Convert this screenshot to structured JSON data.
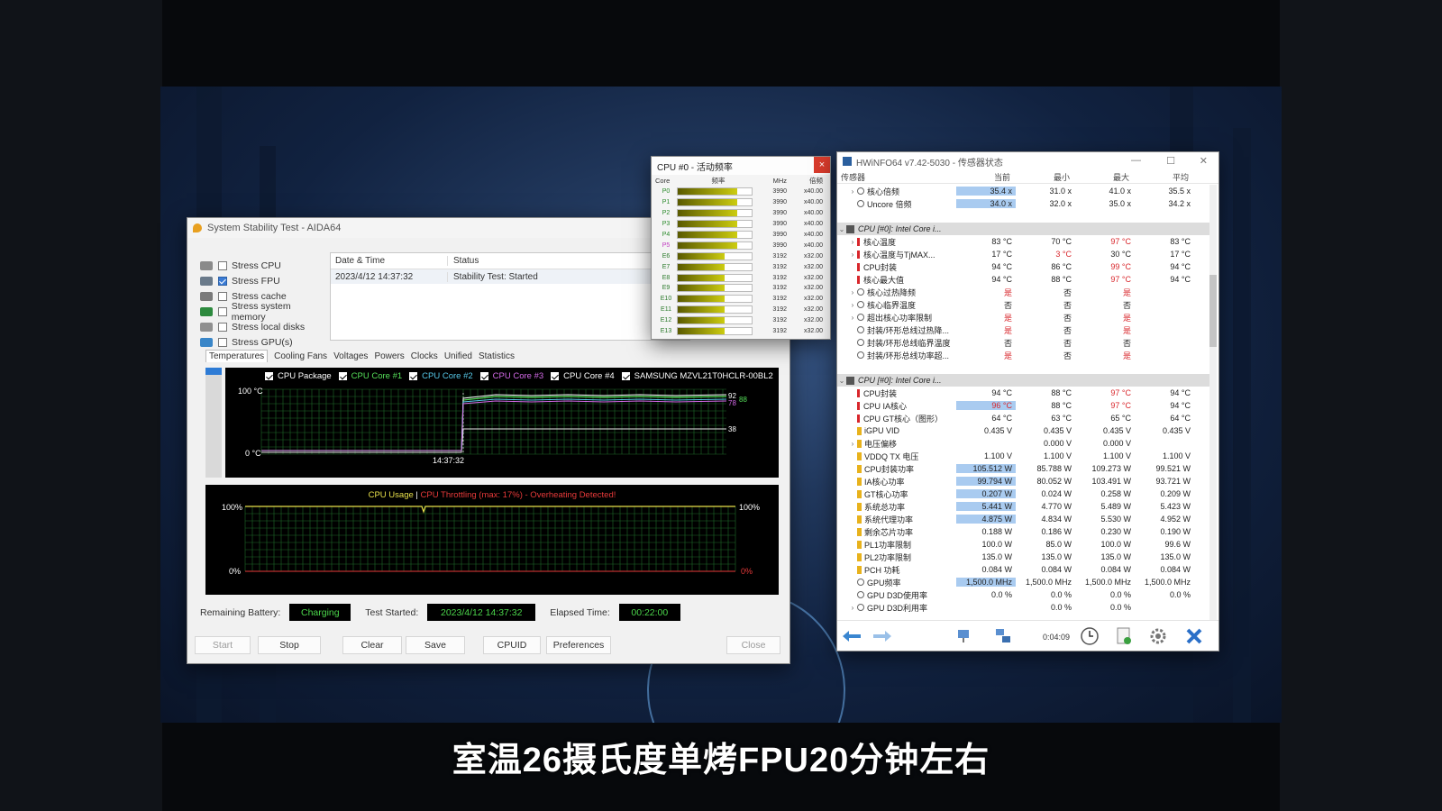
{
  "aida": {
    "title": "System Stability Test - AIDA64",
    "stress_items": [
      {
        "label": "Stress CPU",
        "checked": false
      },
      {
        "label": "Stress FPU",
        "checked": true
      },
      {
        "label": "Stress cache",
        "checked": false
      },
      {
        "label": "Stress system memory",
        "checked": false
      },
      {
        "label": "Stress local disks",
        "checked": false
      },
      {
        "label": "Stress GPU(s)",
        "checked": false
      }
    ],
    "table": {
      "col_datetime": "Date & Time",
      "col_status": "Status",
      "row_datetime": "2023/4/12 14:37:32",
      "row_status": "Stability Test: Started"
    },
    "tabs": [
      "Temperatures",
      "Cooling Fans",
      "Voltages",
      "Powers",
      "Clocks",
      "Unified",
      "Statistics"
    ],
    "temp_legend": [
      {
        "label": "CPU Package",
        "color": "#ffffff"
      },
      {
        "label": "CPU Core #1",
        "color": "#56e05a"
      },
      {
        "label": "CPU Core #2",
        "color": "#56c8e8"
      },
      {
        "label": "CPU Core #3",
        "color": "#d46ae8"
      },
      {
        "label": "CPU Core #4",
        "color": "#ffffff"
      },
      {
        "label": "SAMSUNG MZVL21T0HCLR-00BL2",
        "color": "#ffffff"
      }
    ],
    "temp_top_label": "100 °C",
    "temp_bottom_label": "0 °C",
    "temp_time_label": "14:37:32",
    "temp_readouts": [
      "92",
      "88",
      "78",
      "38"
    ],
    "usage_title_a": "CPU Usage",
    "usage_sep": "|",
    "usage_title_b": "CPU Throttling (max: 17%) - Overheating Detected!",
    "usage_left_top": "100%",
    "usage_left_bottom": "0%",
    "usage_right_top": "100%",
    "usage_right_bottom": "0%",
    "remaining_battery_label": "Remaining Battery:",
    "remaining_battery_value": "Charging",
    "test_started_label": "Test Started:",
    "test_started_value": "2023/4/12 14:37:32",
    "elapsed_label": "Elapsed Time:",
    "elapsed_value": "00:22:00",
    "buttons": {
      "start": "Start",
      "stop": "Stop",
      "clear": "Clear",
      "save": "Save",
      "cpuid": "CPUID",
      "preferences": "Preferences",
      "close": "Close"
    }
  },
  "freq": {
    "title": "CPU #0 - 活动频率",
    "close": "×",
    "hdr_core": "Core",
    "hdr_freq": "频率",
    "hdr_mhz": "MHz",
    "hdr_mult": "倍频",
    "rows": [
      {
        "core": "P0",
        "mhz": "3990",
        "mult": "x40.00",
        "fill": 0.8
      },
      {
        "core": "P1",
        "mhz": "3990",
        "mult": "x40.00",
        "fill": 0.8
      },
      {
        "core": "P2",
        "mhz": "3990",
        "mult": "x40.00",
        "fill": 0.8
      },
      {
        "core": "P3",
        "mhz": "3990",
        "mult": "x40.00",
        "fill": 0.8
      },
      {
        "core": "P4",
        "mhz": "3990",
        "mult": "x40.00",
        "fill": 0.8
      },
      {
        "core": "P5",
        "mhz": "3990",
        "mult": "x40.00",
        "fill": 0.8
      },
      {
        "core": "E6",
        "mhz": "3192",
        "mult": "x32.00",
        "fill": 0.64
      },
      {
        "core": "E7",
        "mhz": "3192",
        "mult": "x32.00",
        "fill": 0.64
      },
      {
        "core": "E8",
        "mhz": "3192",
        "mult": "x32.00",
        "fill": 0.64
      },
      {
        "core": "E9",
        "mhz": "3192",
        "mult": "x32.00",
        "fill": 0.64
      },
      {
        "core": "E10",
        "mhz": "3192",
        "mult": "x32.00",
        "fill": 0.64
      },
      {
        "core": "E11",
        "mhz": "3192",
        "mult": "x32.00",
        "fill": 0.64
      },
      {
        "core": "E12",
        "mhz": "3192",
        "mult": "x32.00",
        "fill": 0.64
      },
      {
        "core": "E13",
        "mhz": "3192",
        "mult": "x32.00",
        "fill": 0.64
      }
    ]
  },
  "hwinfo": {
    "title": "HWiNFO64 v7.42-5030 - 传感器状态",
    "col_sensor": "传感器",
    "col_current": "当前",
    "col_min": "最小",
    "col_max": "最大",
    "col_avg": "平均",
    "rows": [
      {
        "type": "item",
        "icon": "circle",
        "expand": true,
        "name": "核心倍频",
        "cur": "35.4 x",
        "min": "31.0 x",
        "max": "41.0 x",
        "avg": "35.5 x",
        "hl": true
      },
      {
        "type": "item",
        "icon": "circle",
        "expand": false,
        "name": "Uncore 倍频",
        "cur": "34.0 x",
        "min": "32.0 x",
        "max": "35.0 x",
        "avg": "34.2 x",
        "hl": true
      },
      {
        "type": "blank"
      },
      {
        "type": "group",
        "name": "CPU [#0]: Intel Core i..."
      },
      {
        "type": "item",
        "icon": "therm",
        "expand": true,
        "name": "核心温度",
        "cur": "83 °C",
        "min": "70 °C",
        "max": "97 °C",
        "avg": "83 °C",
        "maxred": true
      },
      {
        "type": "item",
        "icon": "therm",
        "expand": true,
        "name": "核心温度与TjMAX...",
        "cur": "17 °C",
        "min": "3 °C",
        "max": "30 °C",
        "avg": "17 °C",
        "minred": true
      },
      {
        "type": "item",
        "icon": "therm",
        "expand": false,
        "name": "CPU封装",
        "cur": "94 °C",
        "min": "86 °C",
        "max": "99 °C",
        "avg": "94 °C",
        "maxred": true
      },
      {
        "type": "item",
        "icon": "therm",
        "expand": false,
        "name": "核心最大值",
        "cur": "94 °C",
        "min": "88 °C",
        "max": "97 °C",
        "avg": "94 °C",
        "maxred": true
      },
      {
        "type": "item",
        "icon": "circle",
        "expand": true,
        "name": "核心过热降频",
        "cur": "是",
        "min": "否",
        "max": "是",
        "avg": "",
        "curred": true,
        "maxred": true
      },
      {
        "type": "item",
        "icon": "circle",
        "expand": true,
        "name": "核心临界温度",
        "cur": "否",
        "min": "否",
        "max": "否",
        "avg": ""
      },
      {
        "type": "item",
        "icon": "circle",
        "expand": true,
        "name": "超出核心功率限制",
        "cur": "是",
        "min": "否",
        "max": "是",
        "avg": "",
        "curred": true,
        "maxred": true
      },
      {
        "type": "item",
        "icon": "circle",
        "expand": false,
        "name": "封装/环形总线过热降...",
        "cur": "是",
        "min": "否",
        "max": "是",
        "avg": "",
        "curred": true,
        "maxred": true
      },
      {
        "type": "item",
        "icon": "circle",
        "expand": false,
        "name": "封装/环形总线临界温度",
        "cur": "否",
        "min": "否",
        "max": "否",
        "avg": ""
      },
      {
        "type": "item",
        "icon": "circle",
        "expand": false,
        "name": "封装/环形总线功率超...",
        "cur": "是",
        "min": "否",
        "max": "是",
        "avg": "",
        "curred": true,
        "maxred": true
      },
      {
        "type": "blank"
      },
      {
        "type": "group",
        "name": "CPU [#0]: Intel Core i..."
      },
      {
        "type": "item",
        "icon": "therm",
        "expand": false,
        "name": "CPU封装",
        "cur": "94 °C",
        "min": "88 °C",
        "max": "97 °C",
        "avg": "94 °C",
        "maxred": true
      },
      {
        "type": "item",
        "icon": "therm",
        "expand": false,
        "name": "CPU IA核心",
        "cur": "96 °C",
        "min": "88 °C",
        "max": "97 °C",
        "avg": "94 °C",
        "hl": true,
        "curred": true,
        "maxred": true
      },
      {
        "type": "item",
        "icon": "therm",
        "expand": false,
        "name": "CPU GT核心（图形）",
        "cur": "64 °C",
        "min": "63 °C",
        "max": "65 °C",
        "avg": "64 °C"
      },
      {
        "type": "item",
        "icon": "bolt",
        "expand": false,
        "name": "iGPU VID",
        "cur": "0.435 V",
        "min": "0.435 V",
        "max": "0.435 V",
        "avg": "0.435 V"
      },
      {
        "type": "item",
        "icon": "bolt",
        "expand": true,
        "name": "电压偏移",
        "cur": "",
        "min": "0.000 V",
        "max": "0.000 V",
        "avg": ""
      },
      {
        "type": "item",
        "icon": "bolt",
        "expand": false,
        "name": "VDDQ TX 电压",
        "cur": "1.100 V",
        "min": "1.100 V",
        "max": "1.100 V",
        "avg": "1.100 V"
      },
      {
        "type": "item",
        "icon": "bolt",
        "expand": false,
        "name": "CPU封装功率",
        "cur": "105.512 W",
        "min": "85.788 W",
        "max": "109.273 W",
        "avg": "99.521 W",
        "hl": true
      },
      {
        "type": "item",
        "icon": "bolt",
        "expand": false,
        "name": "IA核心功率",
        "cur": "99.794 W",
        "min": "80.052 W",
        "max": "103.491 W",
        "avg": "93.721 W",
        "hl": true
      },
      {
        "type": "item",
        "icon": "bolt",
        "expand": false,
        "name": "GT核心功率",
        "cur": "0.207 W",
        "min": "0.024 W",
        "max": "0.258 W",
        "avg": "0.209 W",
        "hl": true
      },
      {
        "type": "item",
        "icon": "bolt",
        "expand": false,
        "name": "系统总功率",
        "cur": "5.441 W",
        "min": "4.770 W",
        "max": "5.489 W",
        "avg": "5.423 W",
        "hl": true
      },
      {
        "type": "item",
        "icon": "bolt",
        "expand": false,
        "name": "系统代理功率",
        "cur": "4.875 W",
        "min": "4.834 W",
        "max": "5.530 W",
        "avg": "4.952 W",
        "hl": true
      },
      {
        "type": "item",
        "icon": "bolt",
        "expand": false,
        "name": "剩余芯片功率",
        "cur": "0.188 W",
        "min": "0.186 W",
        "max": "0.230 W",
        "avg": "0.190 W"
      },
      {
        "type": "item",
        "icon": "bolt",
        "expand": false,
        "name": "PL1功率限制",
        "cur": "100.0 W",
        "min": "85.0 W",
        "max": "100.0 W",
        "avg": "99.6 W"
      },
      {
        "type": "item",
        "icon": "bolt",
        "expand": false,
        "name": "PL2功率限制",
        "cur": "135.0 W",
        "min": "135.0 W",
        "max": "135.0 W",
        "avg": "135.0 W"
      },
      {
        "type": "item",
        "icon": "bolt",
        "expand": false,
        "name": "PCH 功耗",
        "cur": "0.084 W",
        "min": "0.084 W",
        "max": "0.084 W",
        "avg": "0.084 W"
      },
      {
        "type": "item",
        "icon": "circle",
        "expand": false,
        "name": "GPU频率",
        "cur": "1,500.0 MHz",
        "min": "1,500.0 MHz",
        "max": "1,500.0 MHz",
        "avg": "1,500.0 MHz",
        "hl": true
      },
      {
        "type": "item",
        "icon": "circle",
        "expand": false,
        "name": "GPU D3D使用率",
        "cur": "0.0 %",
        "min": "0.0 %",
        "max": "0.0 %",
        "avg": "0.0 %"
      },
      {
        "type": "item",
        "icon": "circle",
        "expand": true,
        "name": "GPU D3D利用率",
        "cur": "",
        "min": "0.0 %",
        "max": "0.0 %",
        "avg": ""
      }
    ],
    "timer": "0:04:09"
  },
  "subtitle": "室温26摄氏度单烤FPU20分钟左右"
}
